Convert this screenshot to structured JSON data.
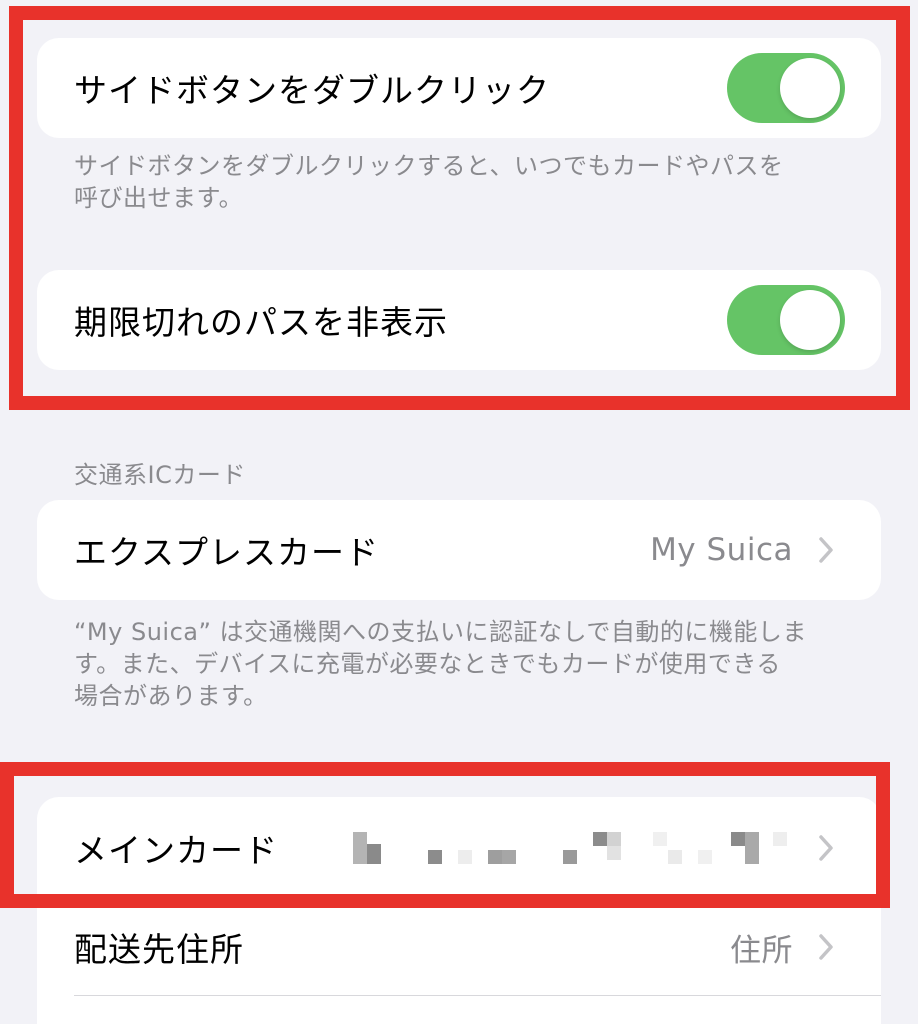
{
  "settings": {
    "double_click": {
      "label": "サイドボタンをダブルクリック",
      "enabled": true,
      "footnote_line1": "サイドボタンをダブルクリックすると、いつでもカードやパスを",
      "footnote_line2": "呼び出せます。"
    },
    "hide_expired": {
      "label": "期限切れのパスを非表示",
      "enabled": true
    }
  },
  "transit": {
    "header": "交通系ICカード",
    "express_card": {
      "label": "エクスプレスカード",
      "value": "My Suica"
    },
    "footnote_line1": "“My Suica” は交通機関への支払いに認証なしで自動的に機能しま",
    "footnote_line2": "す。また、デバイスに充電が必要なときでもカードが使用できる",
    "footnote_line3": "場合があります。"
  },
  "payment": {
    "main_card": {
      "label": "メインカード"
    },
    "shipping_address": {
      "label": "配送先住所",
      "value": "住所"
    }
  },
  "colors": {
    "background": "#f2f2f7",
    "toggle_on": "#65c466",
    "highlight": "#e8322b",
    "secondary_text": "#8a8a8e"
  },
  "icons": [
    "chevron-right-icon"
  ]
}
